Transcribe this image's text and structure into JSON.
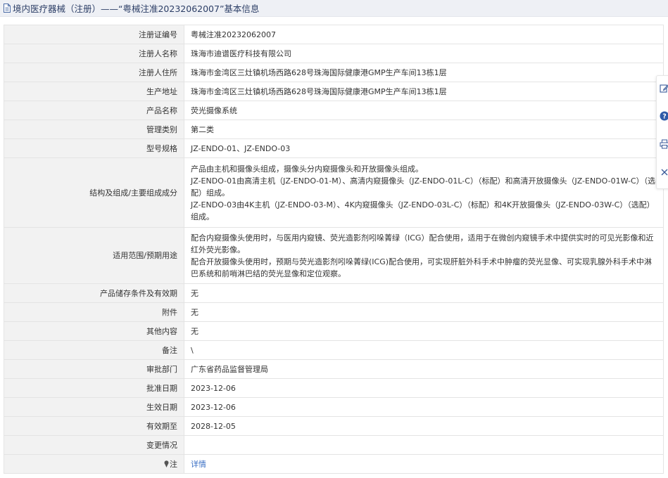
{
  "header": {
    "title": "境内医疗器械（注册）——“粤械注准20232062007”基本信息",
    "icon": "document-icon"
  },
  "rows": [
    {
      "label": "注册证编号",
      "value": [
        "粤械注准20232062007"
      ]
    },
    {
      "label": "注册人名称",
      "value": [
        "珠海市迪谱医疗科技有限公司"
      ]
    },
    {
      "label": "注册人住所",
      "value": [
        "珠海市金湾区三灶镇机场西路628号珠海国际健康港GMP生产车间13栋1层"
      ]
    },
    {
      "label": "生产地址",
      "value": [
        "珠海市金湾区三灶镇机场西路628号珠海国际健康港GMP生产车间13栋1层"
      ]
    },
    {
      "label": "产品名称",
      "value": [
        "荧光摄像系统"
      ]
    },
    {
      "label": "管理类别",
      "value": [
        "第二类"
      ]
    },
    {
      "label": "型号规格",
      "value": [
        "JZ-ENDO-01、JZ-ENDO-03"
      ]
    },
    {
      "label": "结构及组成/主要组成成分",
      "value": [
        "产品由主机和摄像头组成，摄像头分内窥摄像头和开放摄像头组成。",
        "JZ-ENDO-01由高清主机（JZ-ENDO-01-M）、高清内窥摄像头（JZ-ENDO-01L-C）（标配）和高清开放摄像头（JZ-ENDO-01W-C）（选配）组成。",
        "JZ-ENDO-03由4K主机（JZ-ENDO-03-M）、4K内窥摄像头（JZ-ENDO-03L-C）（标配）和4K开放摄像头（JZ-ENDO-03W-C）（选配）组成。"
      ]
    },
    {
      "label": "适用范围/预期用途",
      "value": [
        "配合内窥摄像头使用时，与医用内窥镜、荧光造影剂吲哚菁绿（ICG）配合使用，适用于在微创内窥镜手术中提供实时的可见光影像和近红外荧光影像。",
        "配合开放摄像头使用时，预期与荧光造影剂吲哚菁绿(ICG)配合使用，可实现肝脏外科手术中肿瘤的荧光显像、可实现乳腺外科手术中淋巴系统和前哨淋巴结的荧光显像和定位观察。"
      ]
    },
    {
      "label": "产品储存条件及有效期",
      "value": [
        "无"
      ]
    },
    {
      "label": "附件",
      "value": [
        "无"
      ]
    },
    {
      "label": "其他内容",
      "value": [
        "无"
      ]
    },
    {
      "label": "备注",
      "value": [
        "\\"
      ]
    },
    {
      "label": "审批部门",
      "value": [
        "广东省药品监督管理局"
      ]
    },
    {
      "label": "批准日期",
      "value": [
        "2023-12-06"
      ]
    },
    {
      "label": "生效日期",
      "value": [
        "2023-12-06"
      ]
    },
    {
      "label": "有效期至",
      "value": [
        "2028-12-05"
      ]
    },
    {
      "label": "变更情况",
      "value": [
        ""
      ]
    },
    {
      "label": "注",
      "value": [
        "详情"
      ],
      "link": true,
      "label_icon": "pin-icon"
    }
  ],
  "side_panel": [
    {
      "icon": "edit-icon"
    },
    {
      "icon": "help-icon"
    },
    {
      "icon": "print-icon"
    },
    {
      "icon": "close-icon"
    }
  ],
  "colors": {
    "header_bg": "#eef0f5",
    "label_bg": "#f2f2f2",
    "link": "#3a6fc4",
    "border": "#e4e4e4"
  }
}
